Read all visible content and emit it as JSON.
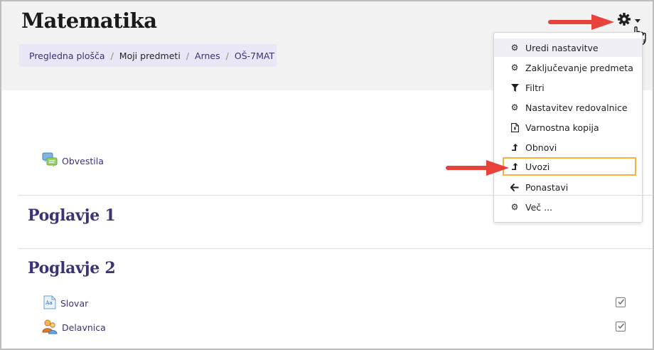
{
  "page": {
    "title": "Matematika"
  },
  "breadcrumb": [
    {
      "label": "Pregledna plošča"
    },
    {
      "label": "Moji predmeti"
    },
    {
      "label": "Arnes"
    },
    {
      "label": "OŠ-7MAT"
    }
  ],
  "settings_menu": {
    "items": [
      {
        "label": "Uredi nastavitve",
        "icon": "gear-icon",
        "highlighted": true
      },
      {
        "label": "Zaključevanje predmeta",
        "icon": "gear-icon"
      },
      {
        "label": "Filtri",
        "icon": "filter-icon"
      },
      {
        "label": "Nastavitev redovalnice",
        "icon": "gear-icon"
      },
      {
        "label": "Varnostna kopija",
        "icon": "file-backup-icon"
      },
      {
        "label": "Obnovi",
        "icon": "level-up-icon"
      },
      {
        "label": "Uvozi",
        "icon": "level-up-icon",
        "boxed": true
      },
      {
        "label": "Ponastavi",
        "icon": "arrow-left-icon"
      },
      {
        "label": "Več ...",
        "icon": "gear-icon"
      }
    ]
  },
  "course": {
    "top_activity": {
      "label": "Obvestila",
      "icon": "forum-icon"
    },
    "sections": [
      {
        "title": "Poglavje 1",
        "activities": []
      },
      {
        "title": "Poglavje 2",
        "activities": [
          {
            "label": "Slovar",
            "icon": "glossary-icon",
            "completed": true
          },
          {
            "label": "Delavnica",
            "icon": "workshop-icon",
            "completed": true
          }
        ]
      }
    ]
  },
  "colors": {
    "accent": "#3a3375",
    "highlight_box": "#f3b33d",
    "annotation_arrow": "#e8423b",
    "header_bg": "#f2f2f2",
    "breadcrumb_bg": "#e9e6f5"
  }
}
